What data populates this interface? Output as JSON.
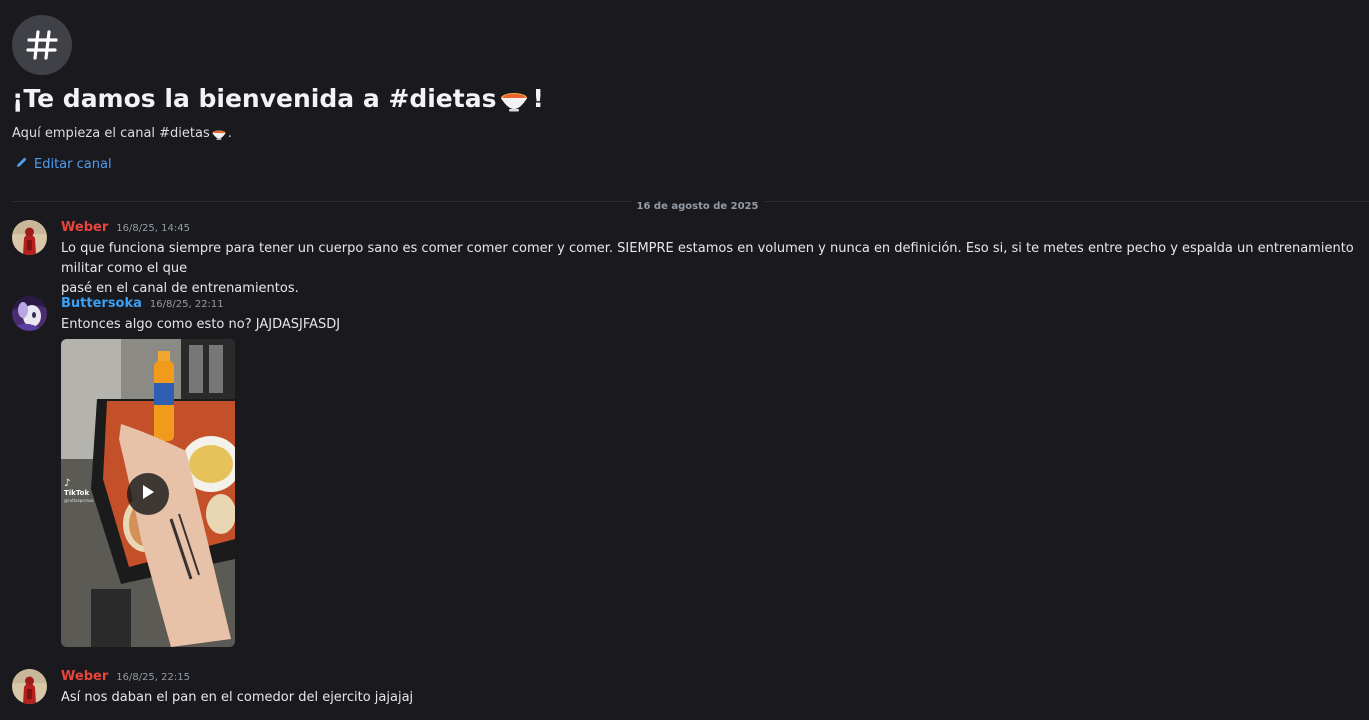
{
  "channel": {
    "welcome_title_prefix": "¡Te damos la bienvenida a #dietas",
    "welcome_title_suffix": "!",
    "welcome_sub_prefix": "Aquí empieza el canal #dietas",
    "welcome_sub_suffix": ".",
    "emoji_icon": "bowl-emoji-icon",
    "edit_label": "Editar canal"
  },
  "date_divider": "16 de agosto de 2025",
  "messages": [
    {
      "author": "Weber",
      "timestamp": "16/8/25, 14:45",
      "lines": [
        "Lo que funciona siempre para tener un cuerpo sano es comer comer comer y comer. SIEMPRE estamos en volumen y nunca en definición. Eso si, si te metes entre pecho y espalda un entrenamiento militar como el que",
        "pasé en el canal de entrenamientos."
      ]
    },
    {
      "author": "Buttersoka",
      "timestamp": "16/8/25, 22:11",
      "lines": [
        "Entonces algo como esto no? JAJDASJFASDJ"
      ],
      "attachment": {
        "type": "video",
        "watermark": "TikTok",
        "watermark_handle": "@rattasperasa"
      }
    },
    {
      "author": "Weber",
      "timestamp": "16/8/25, 22:15",
      "lines": [
        "Así nos daban el pan en el comedor del ejercito jajajaj"
      ]
    }
  ],
  "colors": {
    "background": "#1a1a1e",
    "weber": "#e8453c",
    "buttersoka": "#3aa0f3",
    "link": "#4e9df0"
  }
}
